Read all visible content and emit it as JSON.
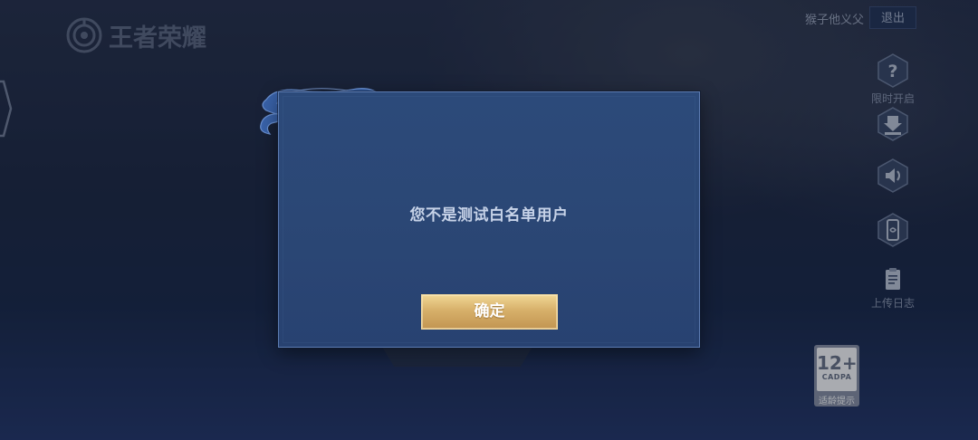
{
  "header": {
    "logo_text": "王者荣耀",
    "username": "猴子他义父",
    "logout_label": "退出"
  },
  "side_menu": [
    {
      "icon": "question-icon",
      "label": "限时开启"
    },
    {
      "icon": "download-icon",
      "label": ""
    },
    {
      "icon": "speaker-icon",
      "label": ""
    },
    {
      "icon": "phone-icon",
      "label": ""
    },
    {
      "icon": "clipboard-icon",
      "label": "上传日志"
    }
  ],
  "dialog": {
    "message": "您不是测试白名单用户",
    "confirm_label": "确定"
  },
  "age_rating": {
    "number": "12+",
    "org": "CADPA",
    "label": "适龄提示"
  },
  "colors": {
    "dialog_bg": "#2c4a7a",
    "dialog_border": "#5c7bb2",
    "confirm_gold": "#d7b06a",
    "message_text": "#c7d3e8"
  }
}
